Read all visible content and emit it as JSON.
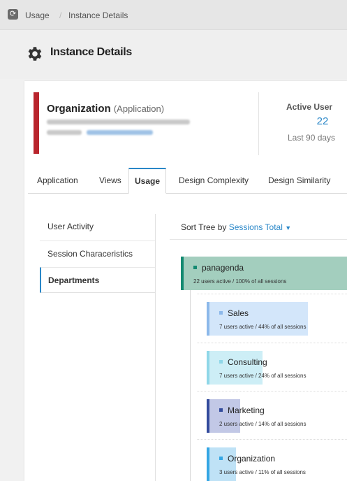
{
  "breadcrumb": {
    "items": [
      "Usage",
      "Instance Details"
    ],
    "separator": "/"
  },
  "page": {
    "title": "Instance Details",
    "icon": "gear-icon"
  },
  "instance": {
    "name": "Organization",
    "type": "(Application)",
    "accent_color": "#b9252d"
  },
  "stats": {
    "label": "Active User",
    "value": "22",
    "period": "Last 90 days"
  },
  "tabs": [
    {
      "label": "Application",
      "active": false
    },
    {
      "label": "Views",
      "active": false
    },
    {
      "label": "Usage",
      "active": true
    },
    {
      "label": "Design Complexity",
      "active": false
    },
    {
      "label": "Design Similarity",
      "active": false
    }
  ],
  "subnav": [
    {
      "label": "User Activity",
      "active": false
    },
    {
      "label": "Session Characeristics",
      "active": false
    },
    {
      "label": "Departments",
      "active": true
    }
  ],
  "sort": {
    "label": "Sort Tree by",
    "value": "Sessions Total"
  },
  "tree": [
    {
      "name": "panagenda",
      "summary": "22 users active / 100% of all sessions",
      "share": 1.0,
      "accent": "#138a71",
      "fill": "#a3cebe",
      "level": 0
    },
    {
      "name": "Sales",
      "summary": "7 users active / 44% of all sessions",
      "share": 0.44,
      "accent": "#8cb8ea",
      "fill": "#d3e6fa",
      "level": 1
    },
    {
      "name": "Consulting",
      "summary": "7 users active / 24% of all sessions",
      "share": 0.24,
      "accent": "#8fd7e8",
      "fill": "#cdeef6",
      "level": 1
    },
    {
      "name": "Marketing",
      "summary": "2 users active / 14% of all sessions",
      "share": 0.14,
      "accent": "#334b9c",
      "fill": "#c2c8e6",
      "level": 1
    },
    {
      "name": "Organization",
      "summary": "3 users active / 11% of all sessions",
      "share": 0.11,
      "accent": "#34a6e4",
      "fill": "#bfe2f6",
      "level": 1
    }
  ]
}
